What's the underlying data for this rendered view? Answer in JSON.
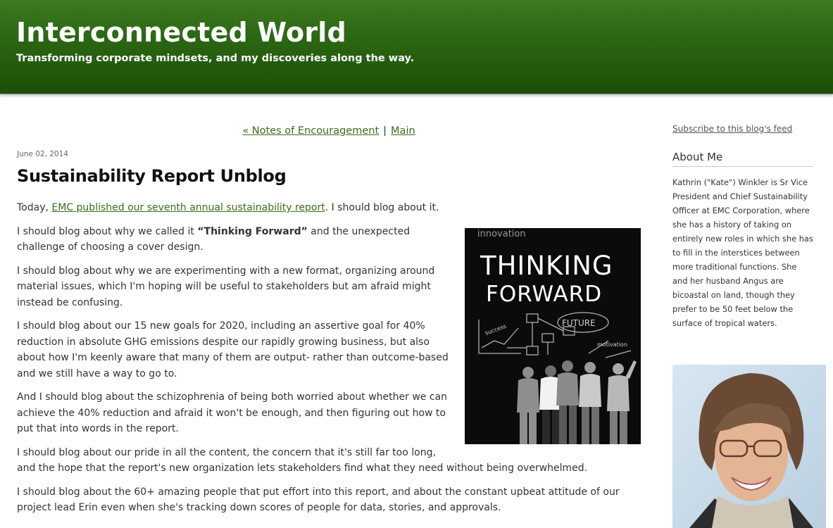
{
  "header": {
    "title": "Interconnected World",
    "tagline": "Transforming corporate mindsets, and my discoveries along the way."
  },
  "nav": {
    "previous_label": "« Notes of Encouragement",
    "separator": "|",
    "main_label": "Main"
  },
  "post": {
    "date": "June 02, 2014",
    "title": "Sustainability Report Unblog",
    "p1_before": "Today, ",
    "p1_link": "EMC published our seventh annual sustainability report",
    "p1_after": ". I should blog about it.",
    "p2_before": "I should blog about why we called it ",
    "p2_bold": "“Thinking Forward”",
    "p2_after": " and the unexpected challenge of choosing a cover design.",
    "p3": "I should blog about why we are experimenting with a new format, organizing around material issues, which I'm hoping will be useful to stakeholders but am afraid might instead be confusing.",
    "p4": "I should blog about our 15 new goals for 2020, including an assertive goal for 40% reduction in absolute GHG emissions despite our rapidly growing business, but also about how I'm keenly aware that many of them are output- rather than outcome-based and we still have a way to go to.",
    "p5": "And I should blog about the schizophrenia of being both worried about whether we can achieve the 40% reduction and afraid it won't be enough, and then figuring out how to put that into words in the report.",
    "p6": "I should blog about our pride in all the content, the concern that it's still far too long, and the hope that the report's new organization lets stakeholders find what they need without being overwhelmed.",
    "p7": "I should blog about the 60+ amazing people that put effort into this report, and about the constant upbeat attitude of our project lead Erin even when she's tracking down scores of people for data, stories, and approvals."
  },
  "cover_image": {
    "line1": "THINKING",
    "line2": "FORWARD",
    "top_word": "innovation",
    "bubble_word": "FUTURE",
    "arrow_word": "success",
    "side_word": "motivation"
  },
  "sidebar": {
    "subscribe_label": "Subscribe to this blog's feed",
    "about_heading": "About Me",
    "about_text": "Kathrin (\"Kate\") Winkler is Sr Vice President and Chief Sustainability Officer at EMC Corporation, where she has a history of taking on entirely new roles in which she has to fill in the interstices between more traditional functions. She and her husband Angus are bicoastal on land, though they prefer to be 50 feet below the surface of tropical waters."
  },
  "colors": {
    "banner_green": "#2a6512",
    "link_green": "#3c6b1a"
  }
}
